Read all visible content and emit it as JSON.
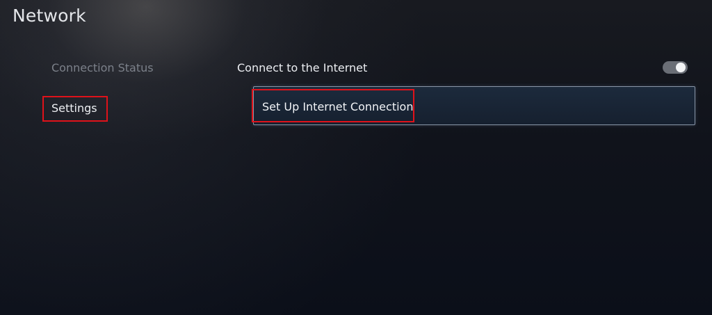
{
  "header": {
    "title": "Network"
  },
  "sidebar": {
    "items": [
      {
        "label": "Connection Status"
      },
      {
        "label": "Settings"
      }
    ]
  },
  "main": {
    "connect_internet": {
      "label": "Connect to the Internet",
      "enabled": true
    },
    "setup_connection": {
      "label": "Set Up Internet Connection"
    }
  },
  "colors": {
    "highlight_box": "#e0121a",
    "focus_row_border": "#8a97a8",
    "dimmed_text": "#7c818a"
  }
}
